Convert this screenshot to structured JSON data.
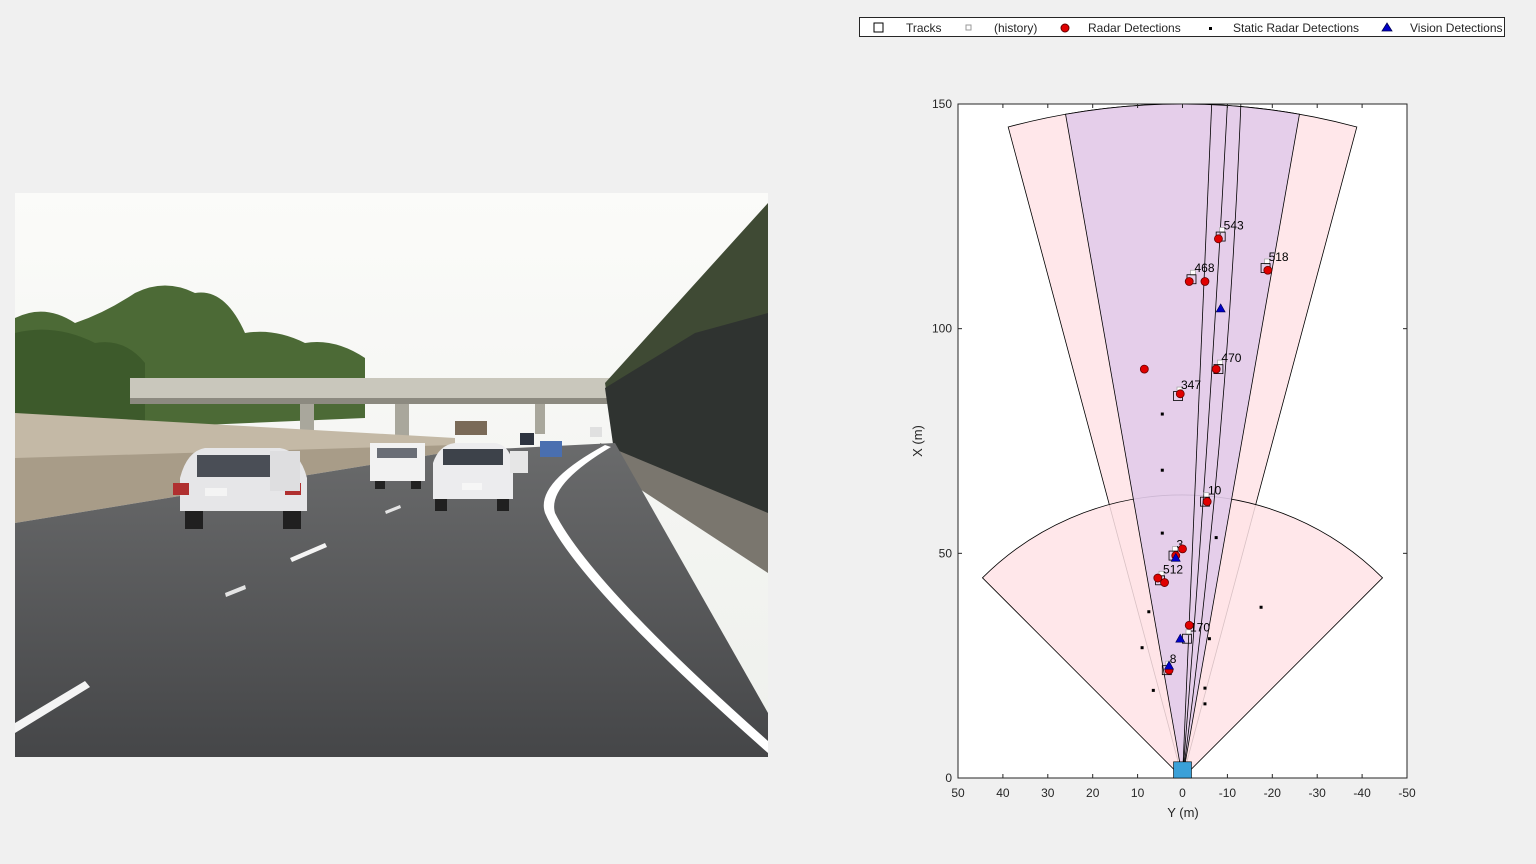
{
  "legend": {
    "entries": [
      {
        "id": "tracks",
        "label": "Tracks",
        "symbol": "square"
      },
      {
        "id": "history",
        "label": "(history)",
        "symbol": "small-square"
      },
      {
        "id": "radar",
        "label": "Radar Detections",
        "symbol": "red-circle"
      },
      {
        "id": "static",
        "label": "Static Radar Detections",
        "symbol": "black-dot"
      },
      {
        "id": "vision",
        "label": "Vision Detections",
        "symbol": "blue-triangle"
      }
    ]
  },
  "colors": {
    "background": "#f0f0f0",
    "axes_bg": "#ffffff",
    "radar_coverage": "#ffe3e6",
    "vision_coverage": "#e2cbea",
    "radar_marker": "#e00000",
    "vision_marker": "#0000c8",
    "ego_vehicle": "#3aa0d8"
  },
  "chart_data": {
    "type": "scatter",
    "xlabel": "Y (m)",
    "ylabel": "X (m)",
    "xlim": [
      50,
      -50
    ],
    "ylim": [
      0,
      150
    ],
    "x_reversed": true,
    "xticks": [
      50,
      40,
      30,
      20,
      10,
      0,
      -10,
      -20,
      -30,
      -40,
      -50
    ],
    "yticks": [
      0,
      50,
      100,
      150
    ],
    "grid": false,
    "legend_position": "top-right",
    "coverage_areas": [
      {
        "name": "long-range radar",
        "range": 150,
        "fov_deg": 30
      },
      {
        "name": "mid-range radar",
        "range": 63,
        "fov_deg": 90
      },
      {
        "name": "vision",
        "range": 150,
        "fov_deg": 20
      }
    ],
    "tracks": [
      {
        "id": "543",
        "y": -8.5,
        "x": 120.5
      },
      {
        "id": "518",
        "y": -18.5,
        "x": 113.5
      },
      {
        "id": "468",
        "y": -2.0,
        "x": 111.0
      },
      {
        "id": "470",
        "y": -8.0,
        "x": 91.0
      },
      {
        "id": "347",
        "y": 1.0,
        "x": 85.0
      },
      {
        "id": "10",
        "y": -5.0,
        "x": 61.5
      },
      {
        "id": "3",
        "y": 2.0,
        "x": 49.5
      },
      {
        "id": "512",
        "y": 5.0,
        "x": 44.0
      },
      {
        "id": "170",
        "y": -1.0,
        "x": 31.0
      },
      {
        "id": "8",
        "y": 3.5,
        "x": 24.0
      }
    ],
    "radar_detections": [
      {
        "y": -8.0,
        "x": 120.0
      },
      {
        "y": -19.0,
        "x": 113.0
      },
      {
        "y": -1.5,
        "x": 110.5
      },
      {
        "y": -5.0,
        "x": 110.5
      },
      {
        "y": 8.5,
        "x": 91.0
      },
      {
        "y": -7.5,
        "x": 91.0
      },
      {
        "y": 0.5,
        "x": 85.5
      },
      {
        "y": -5.5,
        "x": 61.5
      },
      {
        "y": 0.0,
        "x": 51.0
      },
      {
        "y": 1.5,
        "x": 49.5
      },
      {
        "y": 5.5,
        "x": 44.5
      },
      {
        "y": 4.0,
        "x": 43.5
      },
      {
        "y": -1.5,
        "x": 34.0
      },
      {
        "y": 3.0,
        "x": 24.0
      }
    ],
    "static_radar_detections": [
      {
        "y": 4.5,
        "x": 81.0
      },
      {
        "y": 4.5,
        "x": 68.5
      },
      {
        "y": 4.5,
        "x": 54.5
      },
      {
        "y": -7.5,
        "x": 53.5
      },
      {
        "y": 7.5,
        "x": 37.0
      },
      {
        "y": -17.5,
        "x": 38.0
      },
      {
        "y": 9.0,
        "x": 29.0
      },
      {
        "y": -6.0,
        "x": 31.0
      },
      {
        "y": 6.5,
        "x": 19.5
      },
      {
        "y": -5.0,
        "x": 20.0
      },
      {
        "y": -5.0,
        "x": 16.5
      }
    ],
    "vision_detections": [
      {
        "y": -8.5,
        "x": 104.5
      },
      {
        "y": 1.5,
        "x": 49.0
      },
      {
        "y": 0.5,
        "x": 31.0
      },
      {
        "y": 3.0,
        "x": 25.0
      }
    ]
  }
}
